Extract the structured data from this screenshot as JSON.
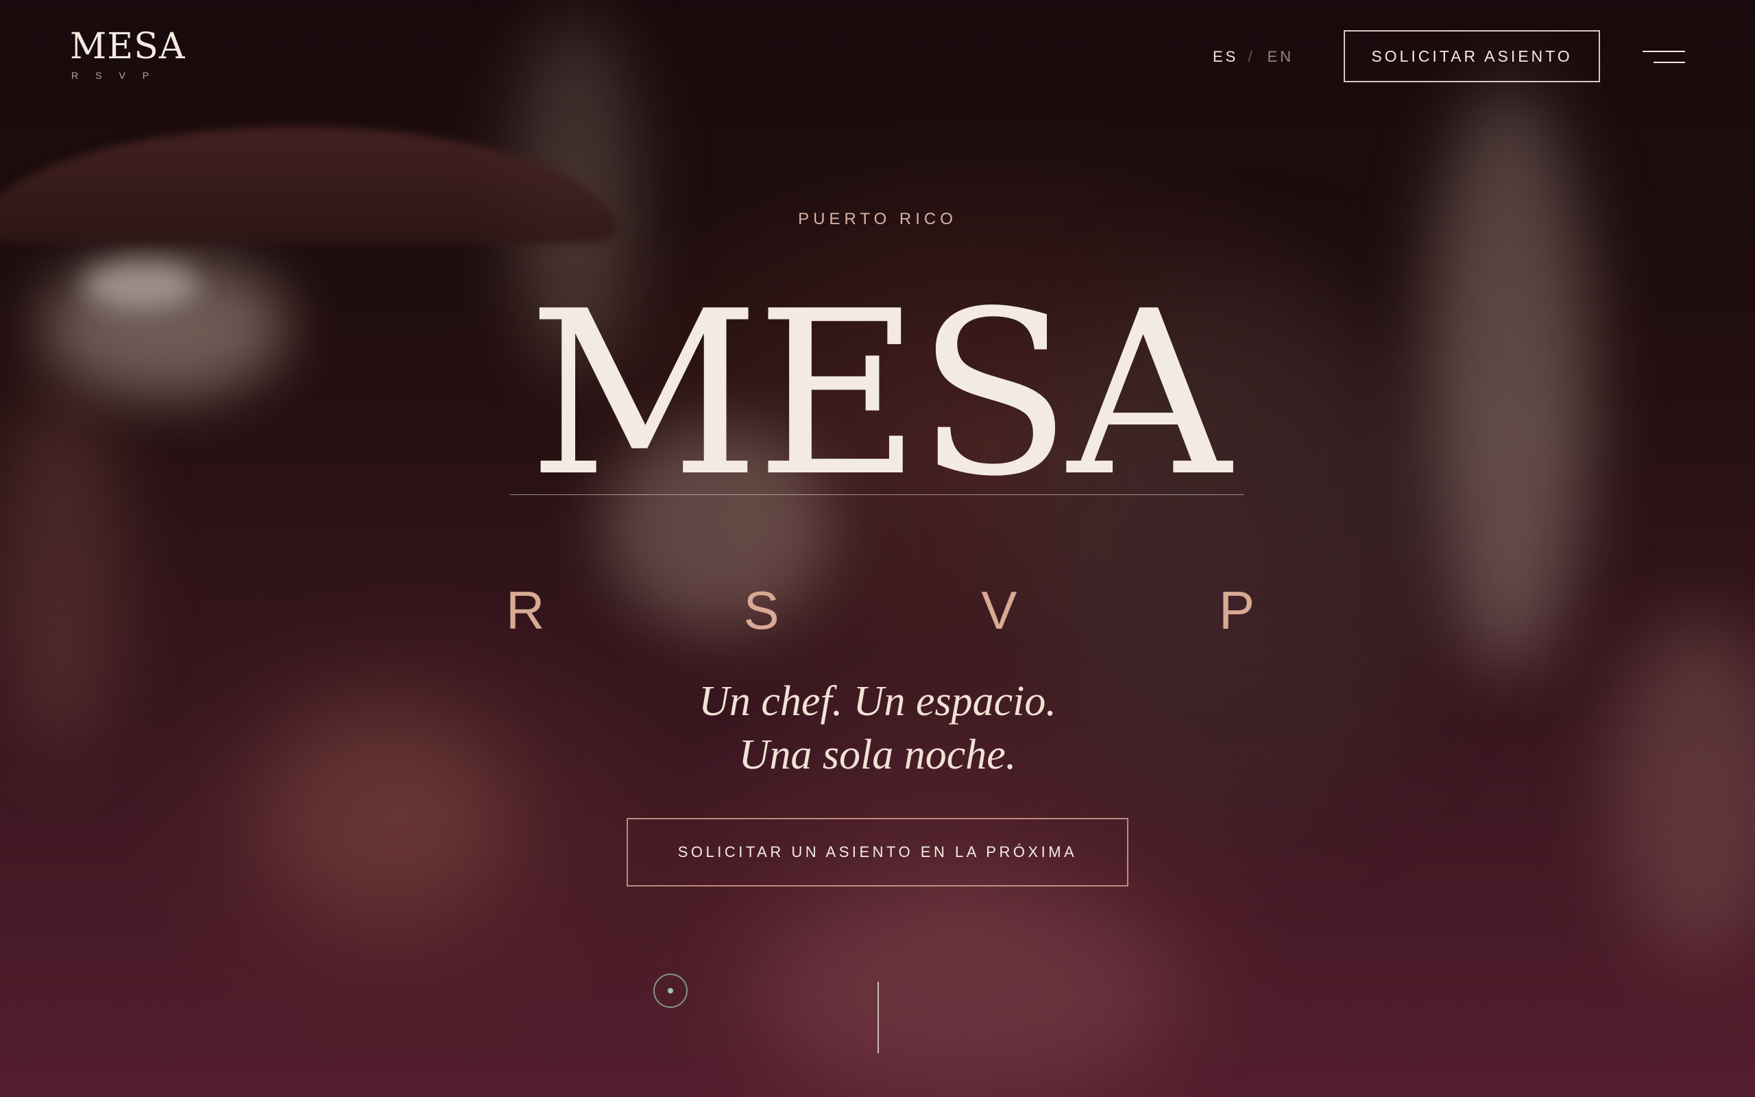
{
  "header": {
    "logo_word": "MESA",
    "logo_sub": "RSVP",
    "lang_es": "ES",
    "lang_separator": "/",
    "lang_en": "EN",
    "cta_label": "SOLICITAR ASIENTO",
    "menu_icon": "menu-icon"
  },
  "hero": {
    "kicker": "PUERTO RICO",
    "title": "MESA",
    "rsvp_letters": [
      "R",
      "S",
      "V",
      "P"
    ],
    "tagline_line1": "Un chef. Un espacio.",
    "tagline_line2": "Una sola noche.",
    "cta_label": "SOLICITAR UN ASIENTO EN LA PRÓXIMA",
    "scroll_icon": "scroll-indicator-icon"
  },
  "colors": {
    "text_primary": "#f3ebe2",
    "accent_rose": "#d9a994",
    "overlay_wine": "#5a2333"
  }
}
